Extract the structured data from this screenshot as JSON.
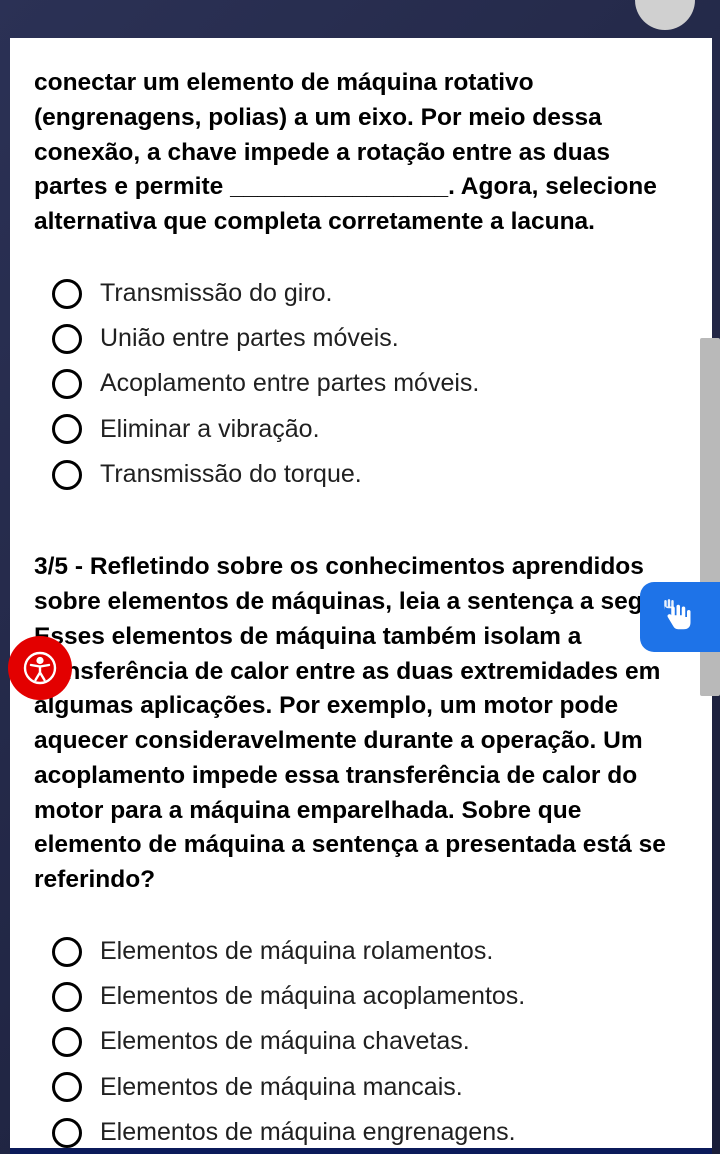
{
  "quiz": {
    "q2": {
      "text": "conectar um elemento de máquina rotativo (engrenagens, polias) a um eixo. Por meio dessa conexão, a chave impede a rotação entre as duas partes e permite ________________. Agora, selecione alternativa que completa corretamente a lacuna.",
      "options": [
        "Transmissão do giro.",
        "União entre partes móveis.",
        "Acoplamento entre partes móveis.",
        "Eliminar a vibração.",
        "Transmissão do torque."
      ]
    },
    "q3": {
      "text": "3/5 - Refletindo sobre os conhecimentos aprendidos sobre elementos de máquinas, leia a sentença a seguir: Esses elementos de máquina também isolam a transferência de calor entre as duas extremidades em algumas aplicações. Por exemplo, um motor pode aquecer consideravelmente durante a operação. Um acoplamento impede essa transferência de calor do motor para a máquina emparelhada. Sobre que elemento de máquina a sentença a presentada está se referindo?",
      "options": [
        "Elementos de máquina rolamentos.",
        "Elementos de máquina acoplamentos.",
        "Elementos de máquina chavetas.",
        "Elementos de máquina mancais.",
        "Elementos de máquina engrenagens."
      ]
    }
  },
  "icons": {
    "accessibility": "accessibility-icon",
    "signlang": "sign-language-icon"
  }
}
